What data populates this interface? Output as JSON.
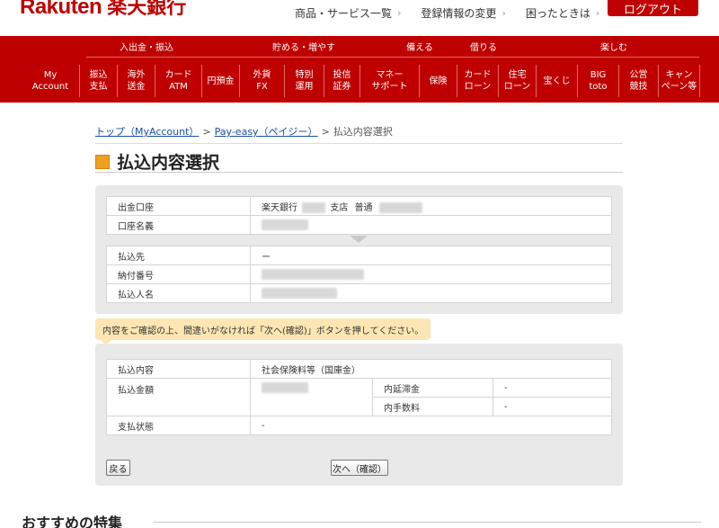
{
  "header": {
    "logo_en": "Rakuten",
    "logo_jp": "楽天銀行",
    "links": [
      "商品・サービス一覧",
      "登録情報の変更",
      "困ったときは"
    ],
    "logout_label": "ログアウト"
  },
  "nav": {
    "groups": [
      "入出金・振込",
      "貯める・増やす",
      "備える",
      "借りる",
      "楽しむ"
    ],
    "items": [
      "My\nAccount",
      "振込\n支払",
      "海外\n送金",
      "カード\nATM",
      "円預金",
      "外貨\nFX",
      "特別\n運用",
      "投信\n証券",
      "マネー\nサポート",
      "保険",
      "カード\nローン",
      "住宅\nローン",
      "宝くじ",
      "BIG\ntoto",
      "公営\n競技",
      "キャン\nペーン等"
    ]
  },
  "breadcrumb": {
    "items": [
      "トップ（MyAccount）",
      "Pay-easy（ペイジー）"
    ],
    "current": "払込内容選択"
  },
  "page_title": "払込内容選択",
  "account": {
    "account_label": "出金口座",
    "account_bank": "楽天銀行",
    "account_branch": "支店",
    "account_type": "普通",
    "name_label": "口座名義"
  },
  "payee": {
    "payee_label": "払込先",
    "payee_value": "ー",
    "number_label": "納付番号",
    "payer_label": "払込人名"
  },
  "notice": "内容をご確認の上、間違いがなければ「次へ(確認)」ボタンを押してください。",
  "details": {
    "content_label": "払込内容",
    "content_value": "社会保険料等（国庫金）",
    "amount_label": "払込金額",
    "late_fee_label": "内延滞金",
    "late_fee_value": "-",
    "fee_label": "内手数料",
    "fee_value": "-",
    "status_label": "支払状態",
    "status_value": "-"
  },
  "buttons": {
    "back": "戻る",
    "next": "次へ（確認）"
  },
  "recommend_title": "おすすめの特集",
  "colors": {
    "brand_red": "#bf0000",
    "title_square": "#f0a020",
    "notice_bg": "#fde6b3",
    "panel_bg": "#e9e9e9",
    "link": "#1a4fa0"
  }
}
